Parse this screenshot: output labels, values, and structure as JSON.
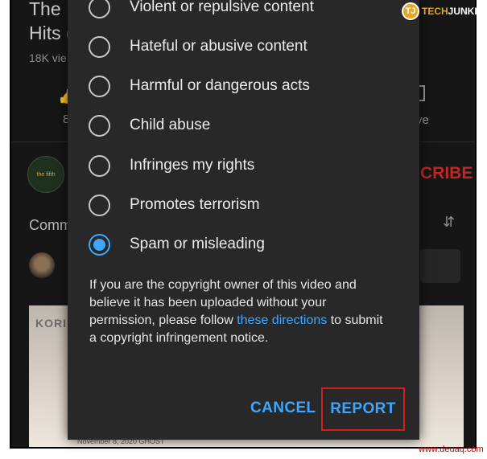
{
  "background": {
    "video_title": "The ... Hits (",
    "views": "18K vie",
    "like_count": "8",
    "save_label": "ve",
    "channel_badge": "the fifth",
    "subscribe_label": "CRIBE",
    "comments_label": "Comm",
    "thumbnail_text": "KORI",
    "thumbnail_credit": "November 8, 2020 GHOST"
  },
  "dialog": {
    "options": [
      {
        "label": "Violent or repulsive content",
        "selected": false
      },
      {
        "label": "Hateful or abusive content",
        "selected": false
      },
      {
        "label": "Harmful or dangerous acts",
        "selected": false
      },
      {
        "label": "Child abuse",
        "selected": false
      },
      {
        "label": "Infringes my rights",
        "selected": false
      },
      {
        "label": "Promotes terrorism",
        "selected": false
      },
      {
        "label": "Spam or misleading",
        "selected": true
      }
    ],
    "notice_before": "If you are the copyright owner of this video and believe it has been uploaded without your permission, please follow ",
    "notice_link": "these directions",
    "notice_after": " to submit a copyright infringement notice.",
    "cancel_label": "CANCEL",
    "report_label": "REPORT",
    "accent_color": "#3ea6ff",
    "highlight_color": "#d01f1f"
  },
  "branding": {
    "logo_mark": "TJ",
    "logo_tech": "TECH",
    "logo_junkie": "JUNKIE",
    "watermark": "www.deuaq.com"
  }
}
